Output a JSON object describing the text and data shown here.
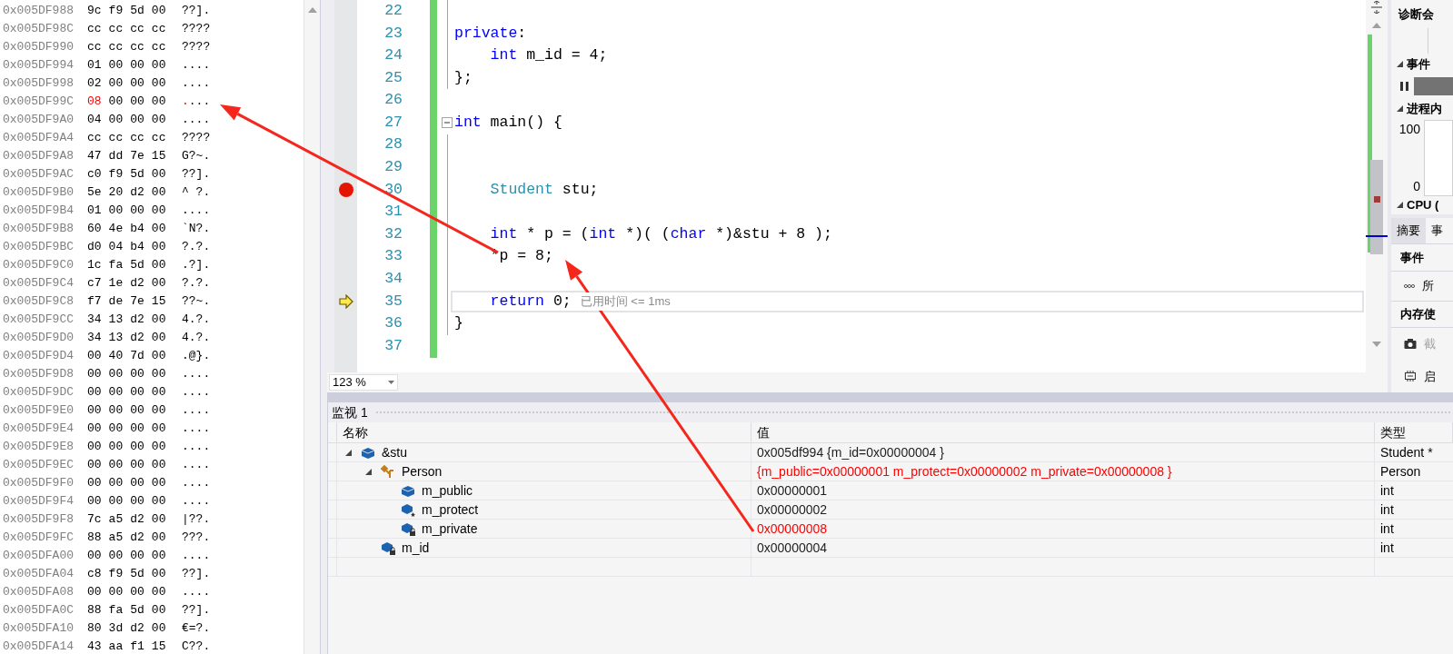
{
  "memory": {
    "rows": [
      {
        "address": "0x005DF988",
        "bytes": [
          "9c",
          "f9",
          "5d",
          "00"
        ],
        "ascii": "??].",
        "changed": false
      },
      {
        "address": "0x005DF98C",
        "bytes": [
          "cc",
          "cc",
          "cc",
          "cc"
        ],
        "ascii": "????",
        "changed": false
      },
      {
        "address": "0x005DF990",
        "bytes": [
          "cc",
          "cc",
          "cc",
          "cc"
        ],
        "ascii": "????",
        "changed": false
      },
      {
        "address": "0x005DF994",
        "bytes": [
          "01",
          "00",
          "00",
          "00"
        ],
        "ascii": "....",
        "changed": false
      },
      {
        "address": "0x005DF998",
        "bytes": [
          "02",
          "00",
          "00",
          "00"
        ],
        "ascii": "....",
        "changed": false
      },
      {
        "address": "0x005DF99C",
        "bytes": [
          "08",
          "00",
          "00",
          "00"
        ],
        "ascii": "....",
        "changed": true
      },
      {
        "address": "0x005DF9A0",
        "bytes": [
          "04",
          "00",
          "00",
          "00"
        ],
        "ascii": "....",
        "changed": false
      },
      {
        "address": "0x005DF9A4",
        "bytes": [
          "cc",
          "cc",
          "cc",
          "cc"
        ],
        "ascii": "????",
        "changed": false
      },
      {
        "address": "0x005DF9A8",
        "bytes": [
          "47",
          "dd",
          "7e",
          "15"
        ],
        "ascii": "G?~.",
        "changed": false
      },
      {
        "address": "0x005DF9AC",
        "bytes": [
          "c0",
          "f9",
          "5d",
          "00"
        ],
        "ascii": "??].",
        "changed": false
      },
      {
        "address": "0x005DF9B0",
        "bytes": [
          "5e",
          "20",
          "d2",
          "00"
        ],
        "ascii": "^ ?.",
        "changed": false
      },
      {
        "address": "0x005DF9B4",
        "bytes": [
          "01",
          "00",
          "00",
          "00"
        ],
        "ascii": "....",
        "changed": false
      },
      {
        "address": "0x005DF9B8",
        "bytes": [
          "60",
          "4e",
          "b4",
          "00"
        ],
        "ascii": "`N?.",
        "changed": false
      },
      {
        "address": "0x005DF9BC",
        "bytes": [
          "d0",
          "04",
          "b4",
          "00"
        ],
        "ascii": "?.?.",
        "changed": false
      },
      {
        "address": "0x005DF9C0",
        "bytes": [
          "1c",
          "fa",
          "5d",
          "00"
        ],
        "ascii": ".?].",
        "changed": false
      },
      {
        "address": "0x005DF9C4",
        "bytes": [
          "c7",
          "1e",
          "d2",
          "00"
        ],
        "ascii": "?.?.",
        "changed": false
      },
      {
        "address": "0x005DF9C8",
        "bytes": [
          "f7",
          "de",
          "7e",
          "15"
        ],
        "ascii": "??~.",
        "changed": false
      },
      {
        "address": "0x005DF9CC",
        "bytes": [
          "34",
          "13",
          "d2",
          "00"
        ],
        "ascii": "4.?.",
        "changed": false
      },
      {
        "address": "0x005DF9D0",
        "bytes": [
          "34",
          "13",
          "d2",
          "00"
        ],
        "ascii": "4.?.",
        "changed": false
      },
      {
        "address": "0x005DF9D4",
        "bytes": [
          "00",
          "40",
          "7d",
          "00"
        ],
        "ascii": ".@}.",
        "changed": false
      },
      {
        "address": "0x005DF9D8",
        "bytes": [
          "00",
          "00",
          "00",
          "00"
        ],
        "ascii": "....",
        "changed": false
      },
      {
        "address": "0x005DF9DC",
        "bytes": [
          "00",
          "00",
          "00",
          "00"
        ],
        "ascii": "....",
        "changed": false
      },
      {
        "address": "0x005DF9E0",
        "bytes": [
          "00",
          "00",
          "00",
          "00"
        ],
        "ascii": "....",
        "changed": false
      },
      {
        "address": "0x005DF9E4",
        "bytes": [
          "00",
          "00",
          "00",
          "00"
        ],
        "ascii": "....",
        "changed": false
      },
      {
        "address": "0x005DF9E8",
        "bytes": [
          "00",
          "00",
          "00",
          "00"
        ],
        "ascii": "....",
        "changed": false
      },
      {
        "address": "0x005DF9EC",
        "bytes": [
          "00",
          "00",
          "00",
          "00"
        ],
        "ascii": "....",
        "changed": false
      },
      {
        "address": "0x005DF9F0",
        "bytes": [
          "00",
          "00",
          "00",
          "00"
        ],
        "ascii": "....",
        "changed": false
      },
      {
        "address": "0x005DF9F4",
        "bytes": [
          "00",
          "00",
          "00",
          "00"
        ],
        "ascii": "....",
        "changed": false
      },
      {
        "address": "0x005DF9F8",
        "bytes": [
          "7c",
          "a5",
          "d2",
          "00"
        ],
        "ascii": "|??.",
        "changed": false
      },
      {
        "address": "0x005DF9FC",
        "bytes": [
          "88",
          "a5",
          "d2",
          "00"
        ],
        "ascii": "???.",
        "changed": false
      },
      {
        "address": "0x005DFA00",
        "bytes": [
          "00",
          "00",
          "00",
          "00"
        ],
        "ascii": "....",
        "changed": false
      },
      {
        "address": "0x005DFA04",
        "bytes": [
          "c8",
          "f9",
          "5d",
          "00"
        ],
        "ascii": "??].",
        "changed": false
      },
      {
        "address": "0x005DFA08",
        "bytes": [
          "00",
          "00",
          "00",
          "00"
        ],
        "ascii": "....",
        "changed": false
      },
      {
        "address": "0x005DFA0C",
        "bytes": [
          "88",
          "fa",
          "5d",
          "00"
        ],
        "ascii": "??].",
        "changed": false
      },
      {
        "address": "0x005DFA10",
        "bytes": [
          "80",
          "3d",
          "d2",
          "00"
        ],
        "ascii": "€=?.",
        "changed": false
      },
      {
        "address": "0x005DFA14",
        "bytes": [
          "43",
          "aa",
          "f1",
          "15"
        ],
        "ascii": "C??.",
        "changed": false
      }
    ]
  },
  "editor": {
    "lines": [
      {
        "number": "22",
        "breakpoint": false,
        "current": false,
        "fold_start": false,
        "in_block": true
      },
      {
        "number": "23",
        "breakpoint": false,
        "current": false,
        "fold_start": false,
        "in_block": true,
        "tokens": [
          {
            "text": "private",
            "kind": "keyword"
          },
          {
            "text": ":",
            "kind": "plain"
          }
        ]
      },
      {
        "number": "24",
        "breakpoint": false,
        "current": false,
        "fold_start": false,
        "in_block": true,
        "tokens": [
          {
            "text": "    int",
            "kind": "keyword"
          },
          {
            "text": " m_id = 4;",
            "kind": "plain"
          }
        ]
      },
      {
        "number": "25",
        "breakpoint": false,
        "current": false,
        "fold_start": false,
        "in_block": true,
        "tokens": [
          {
            "text": "};",
            "kind": "plain"
          }
        ]
      },
      {
        "number": "26",
        "breakpoint": false,
        "current": false,
        "fold_start": false,
        "in_block": false
      },
      {
        "number": "27",
        "breakpoint": false,
        "current": false,
        "fold_start": true,
        "in_block": false,
        "tokens": [
          {
            "text": "int",
            "kind": "keyword"
          },
          {
            "text": " main() {",
            "kind": "plain"
          }
        ]
      },
      {
        "number": "28",
        "breakpoint": false,
        "current": false,
        "fold_start": false,
        "in_block": true
      },
      {
        "number": "29",
        "breakpoint": false,
        "current": false,
        "fold_start": false,
        "in_block": true
      },
      {
        "number": "30",
        "breakpoint": true,
        "current": false,
        "fold_start": false,
        "in_block": true,
        "tokens": [
          {
            "text": "    Student",
            "kind": "type"
          },
          {
            "text": " stu;",
            "kind": "plain"
          }
        ]
      },
      {
        "number": "31",
        "breakpoint": false,
        "current": false,
        "fold_start": false,
        "in_block": true
      },
      {
        "number": "32",
        "breakpoint": false,
        "current": false,
        "fold_start": false,
        "in_block": true,
        "tokens": [
          {
            "text": "    int",
            "kind": "keyword"
          },
          {
            "text": " * p = (",
            "kind": "plain"
          },
          {
            "text": "int",
            "kind": "keyword"
          },
          {
            "text": " *)( (",
            "kind": "plain"
          },
          {
            "text": "char",
            "kind": "keyword"
          },
          {
            "text": " *)&stu + 8 );",
            "kind": "plain"
          }
        ]
      },
      {
        "number": "33",
        "breakpoint": false,
        "current": false,
        "fold_start": false,
        "in_block": true,
        "tokens": [
          {
            "text": "    *p = 8;",
            "kind": "plain"
          }
        ]
      },
      {
        "number": "34",
        "breakpoint": false,
        "current": false,
        "fold_start": false,
        "in_block": true
      },
      {
        "number": "35",
        "breakpoint": false,
        "current": true,
        "fold_start": false,
        "in_block": true,
        "tokens": [
          {
            "text": "    return",
            "kind": "keyword"
          },
          {
            "text": " 0;",
            "kind": "plain"
          }
        ],
        "hint": "已用时间 <= 1ms"
      },
      {
        "number": "36",
        "breakpoint": false,
        "current": false,
        "fold_start": false,
        "in_block": true,
        "tokens": [
          {
            "text": "}",
            "kind": "plain"
          }
        ]
      },
      {
        "number": "37",
        "breakpoint": false,
        "current": false,
        "fold_start": false,
        "in_block": false
      }
    ],
    "zoom": "123 %"
  },
  "diagnostics": {
    "title": "诊断会",
    "events_label": "事件",
    "process_label": "进程内",
    "axis_max": "100",
    "axis_min": "0",
    "cpu_label": "CPU (",
    "tabs": [
      {
        "label": "摘要",
        "selected": true
      },
      {
        "label": "事",
        "selected": false
      }
    ],
    "events_heading": "事件",
    "events_item": "所",
    "memory_heading": "内存使",
    "actions": [
      {
        "label": "截",
        "kind": "camera",
        "disabled": true
      },
      {
        "label": "启",
        "kind": "chip",
        "disabled": false
      }
    ]
  },
  "watch": {
    "title": "监视 1",
    "columns": [
      "名称",
      "值",
      "类型"
    ],
    "rows": [
      {
        "name": "&stu",
        "kind": "object",
        "value": "0x005df994 {m_id=0x00000004 }",
        "type": "Student *",
        "changed": false,
        "expanded": true,
        "children": [
          {
            "name": "Person",
            "kind": "base",
            "value": "{m_public=0x00000001 m_protect=0x00000002 m_private=0x00000008 }",
            "type": "Person",
            "changed": true,
            "expanded": true,
            "children": [
              {
                "name": "m_public",
                "kind": "field",
                "value": "0x00000001",
                "type": "int",
                "changed": false
              },
              {
                "name": "m_protect",
                "kind": "protected",
                "value": "0x00000002",
                "type": "int",
                "changed": false
              },
              {
                "name": "m_private",
                "kind": "private",
                "value": "0x00000008",
                "type": "int",
                "changed": true
              }
            ]
          },
          {
            "name": "m_id",
            "kind": "private",
            "value": "0x00000004",
            "type": "int",
            "changed": false
          }
        ]
      }
    ]
  }
}
